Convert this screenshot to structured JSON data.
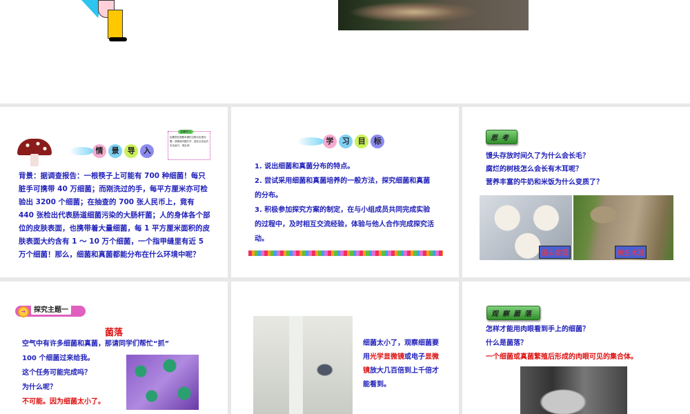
{
  "slide_top": {},
  "slide_intro": {
    "title_chars": [
      "情",
      "景",
      "导",
      "入"
    ],
    "note_title": "温馨提示",
    "note_body": "如果您在观看本课件过程中出现问题，请使用闪图打开，若在点击后仍无法运行，请见谅！",
    "body": "背景：据调查报告：一根筷子上可能有 700 种细菌！每只脏手可携带 40 万细菌；而刚洗过的手，每平方厘米亦可检验出 3200 个细菌；在抽查的 700 张人民币上，竟有 440 张检出代表肠道细菌污染的大肠杆菌；人的身体各个部位的皮肤表面，也携带着大量细菌，每 1 平方厘米面积的皮肤表面大约含有 1 ～ 10 万个细菌，一个指甲缝里有近 5 万个细菌！那么，细菌和真菌都能分布在什么环境中呢？"
  },
  "slide_goals": {
    "title_chars": [
      "学",
      "习",
      "目",
      "标"
    ],
    "items": [
      "1. 说出细菌和真菌分布的特点。",
      "2. 尝试采用细菌和真菌培养的一般方法，探究细菌和真菌的分布。",
      "3. 积极参加探究方案的制定，在与小组成员共同完成实验的过程中，及时相互交流经验，体验与他人合作完成探究活动。"
    ]
  },
  "slide_think": {
    "tag": "思考",
    "questions": [
      "馒头存放时间久了为什么会长毛？",
      "腐烂的树枝怎么会长有木耳呢？",
      "营养丰富的牛奶和米饭为什么变质了？"
    ],
    "captions": [
      "馒头发霉",
      "树生木耳"
    ]
  },
  "slide_topic1": {
    "tag": "探究主题一",
    "heading": "菌落",
    "lines": [
      "空气中有许多细菌和真菌，那请同学们帮忙“抓”",
      "100 个细菌过来给我。",
      "这个任务可能完成吗？",
      "为什么呢？"
    ],
    "answer": "不可能。因为细菌太小了。"
  },
  "slide_microscope": {
    "t1": "细菌太小了，观察细菌要用",
    "r1": "光学显微镜",
    "t2": "或电子",
    "r2": "显微镜",
    "t3": "放大几百倍到上千倍才能看到。"
  },
  "slide_colony": {
    "tag": "观察菌落",
    "questions": [
      "怎样才能用肉眼看到手上的细菌？",
      "什么是菌落？"
    ],
    "answer": "一个细菌或真菌繁殖后形成的肉眼可见的集合体。"
  }
}
